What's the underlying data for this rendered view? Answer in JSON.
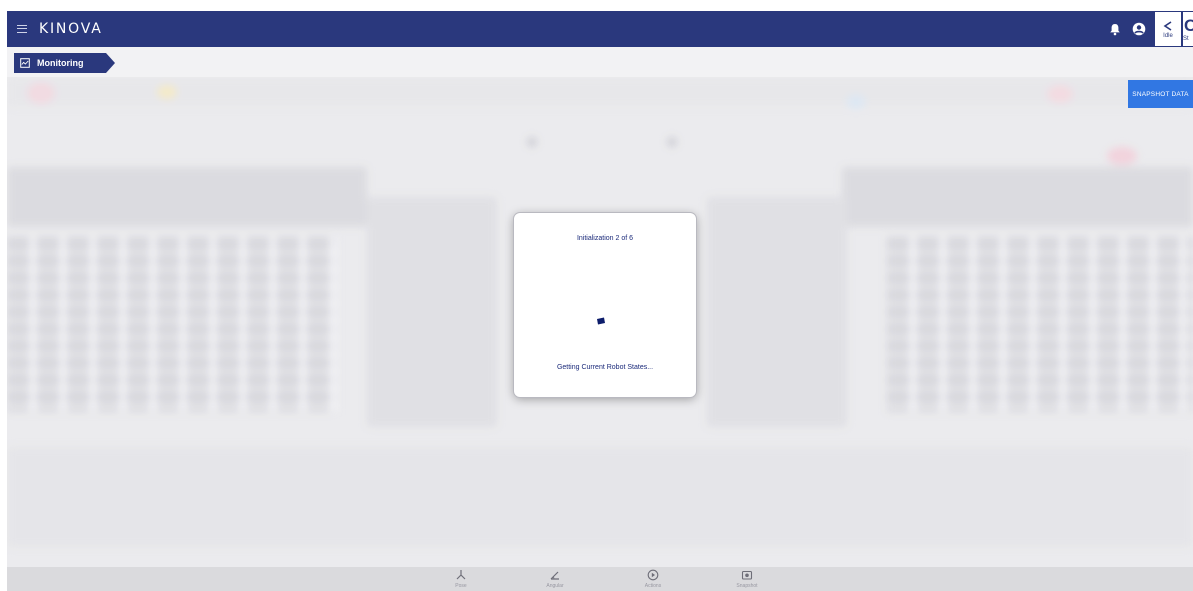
{
  "header": {
    "brand": "KINOVA",
    "icons": [
      "menu-icon",
      "bell-icon",
      "account-icon"
    ],
    "status_tiles": [
      {
        "icon": "arm-pose-icon",
        "label": "Idle"
      },
      {
        "icon": "connection-icon",
        "label": "St"
      }
    ]
  },
  "breadcrumb": {
    "label": "Monitoring",
    "icon": "monitor-chart-icon"
  },
  "content": {
    "snapshot_button": "SNAPSHOT DATA"
  },
  "bottom_nav": {
    "items": [
      {
        "icon": "pose-icon",
        "label": "Pose"
      },
      {
        "icon": "angular-icon",
        "label": "Angular"
      },
      {
        "icon": "actions-icon",
        "label": "Actions"
      },
      {
        "icon": "snapshot-icon",
        "label": "Snapshot"
      }
    ]
  },
  "modal": {
    "title": "Initialization 2 of 6",
    "status": "Getting Current Robot States..."
  },
  "colors": {
    "primary": "#0d1d6b",
    "accent": "#1565e0",
    "text": "#1b2a7a"
  }
}
